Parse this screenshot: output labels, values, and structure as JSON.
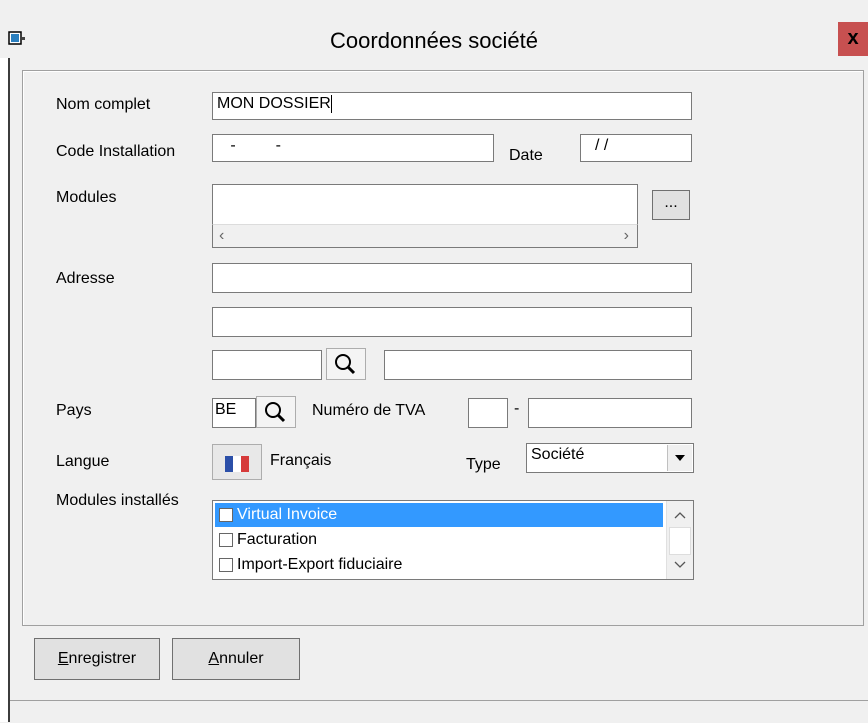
{
  "window": {
    "title": "Coordonnées société",
    "close_label": "x"
  },
  "form": {
    "nom_complet_label": "Nom complet",
    "nom_complet_value": "MON DOSSIER",
    "code_installation_label": "Code Installation",
    "code_installation_value": "   -         -",
    "date_label": "Date",
    "date_value": "/ /",
    "modules_label": "Modules",
    "modules_button": "...",
    "adresse_label": "Adresse",
    "pays_label": "Pays",
    "pays_value": "BE",
    "tva_label": "Numéro de TVA",
    "tva_separator": "-",
    "langue_label": "Langue",
    "langue_value": "Français",
    "type_label": "Type",
    "type_value": "Société",
    "modules_installes_label": "Modules installés",
    "modules_installes": [
      {
        "label": "Virtual Invoice",
        "checked": false,
        "selected": true
      },
      {
        "label": "Facturation",
        "checked": false,
        "selected": false
      },
      {
        "label": "Import-Export fiduciaire",
        "checked": false,
        "selected": false
      }
    ]
  },
  "buttons": {
    "save_prefix": "E",
    "save_rest": "nregistrer",
    "cancel_prefix": "A",
    "cancel_rest": "nnuler"
  },
  "colors": {
    "selection": "#3399ff",
    "close": "#c75050"
  }
}
